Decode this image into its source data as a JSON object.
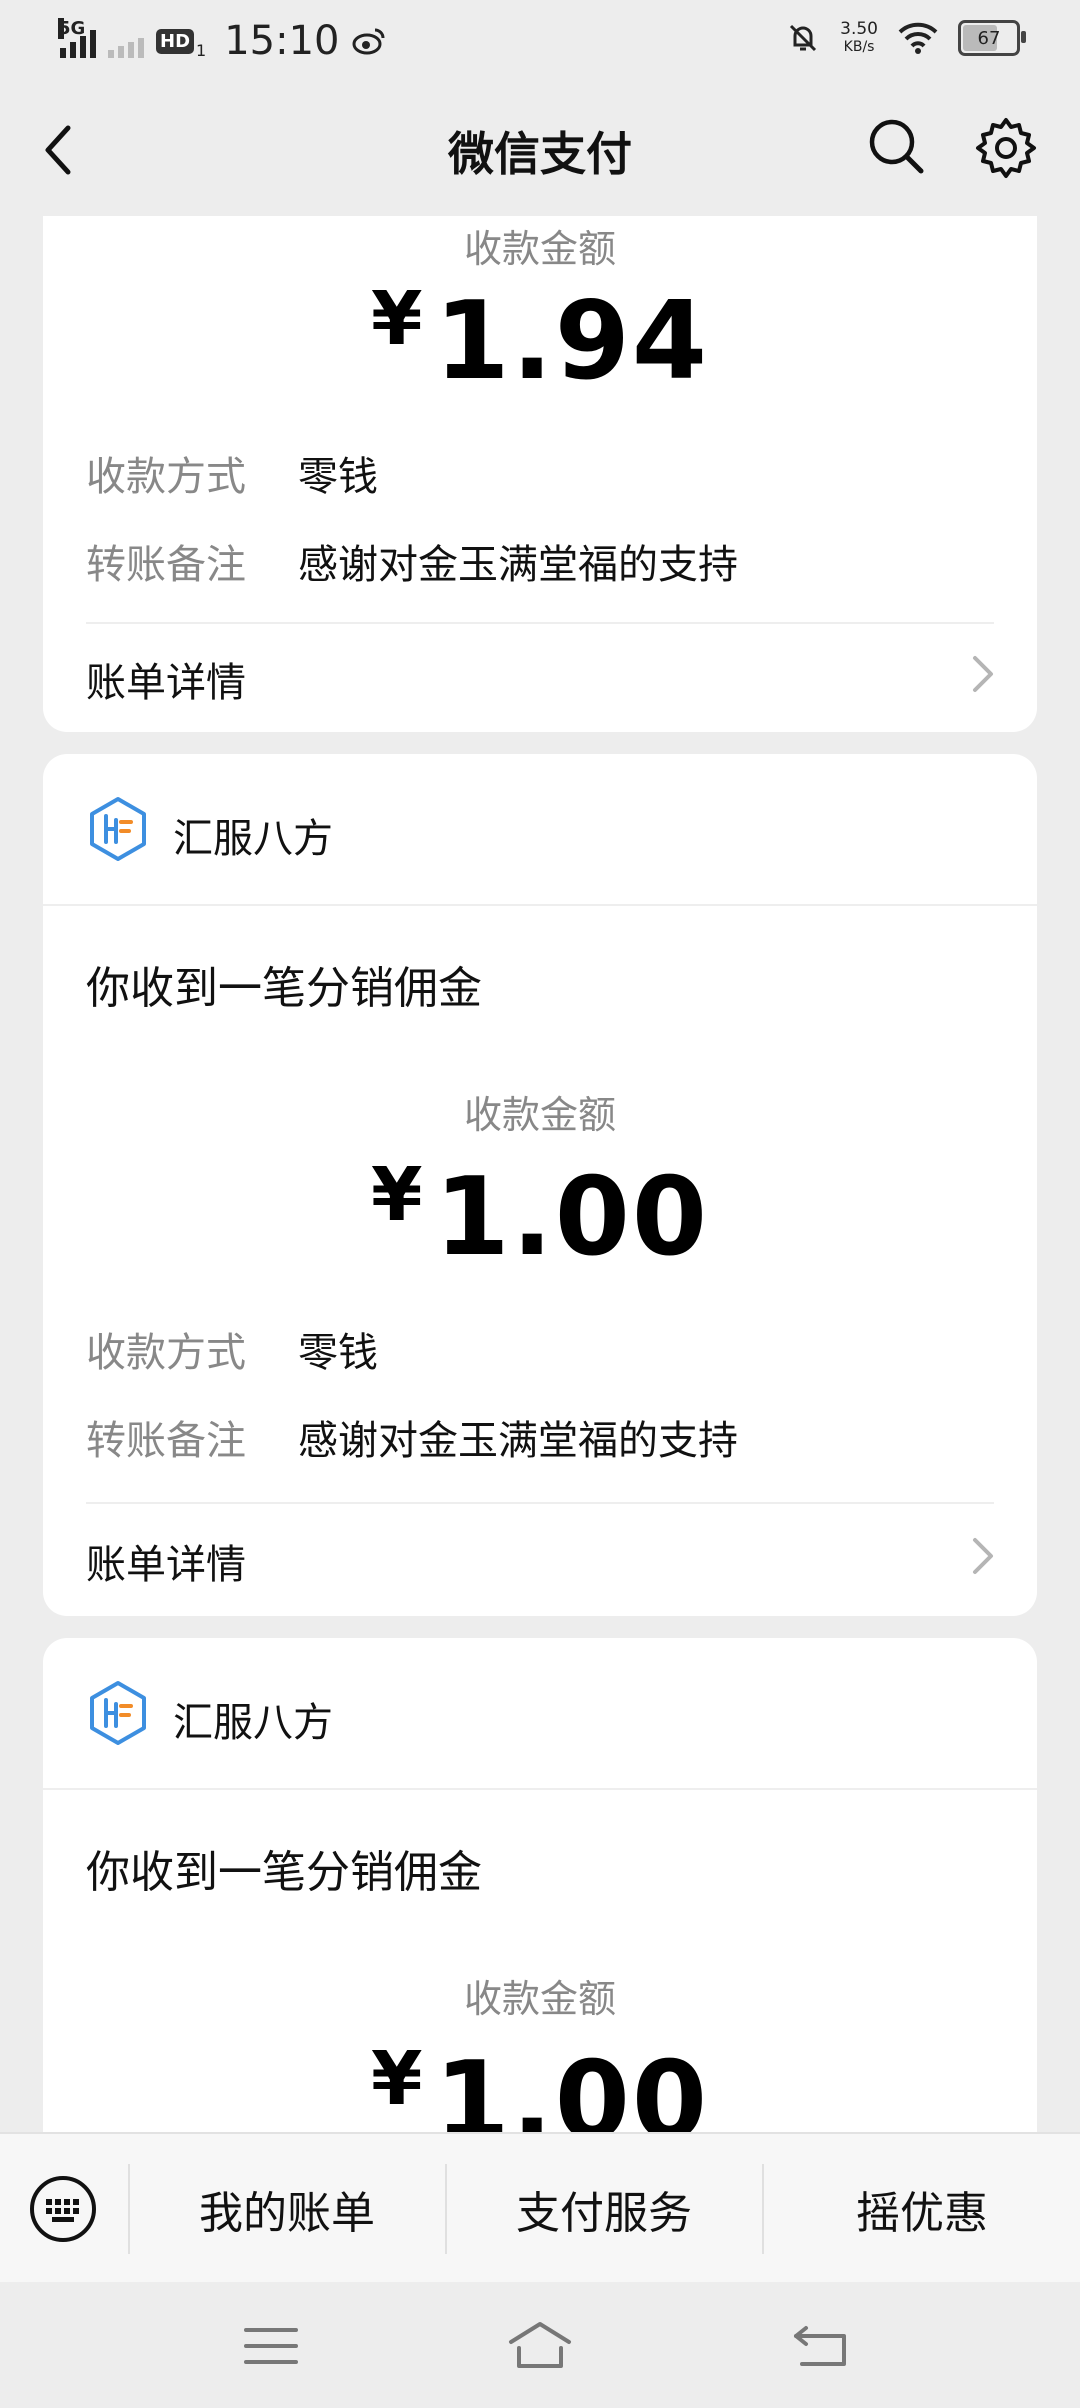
{
  "status_bar": {
    "network": "5G",
    "hd_badge": "HD",
    "sim_slot": "1",
    "time": "15:10",
    "speed_value": "3.50",
    "speed_unit": "KB/s",
    "battery": "67"
  },
  "header": {
    "title": "微信支付"
  },
  "cards": [
    {
      "amount_label": "收款金额",
      "currency": "¥",
      "amount": "1.94",
      "method_label": "收款方式",
      "method_value": "零钱",
      "note_label": "转账备注",
      "note_value": "感谢对金玉满堂福的支持",
      "detail_label": "账单详情"
    },
    {
      "merchant": "汇服八方",
      "headline": "你收到一笔分销佣金",
      "amount_label": "收款金额",
      "currency": "¥",
      "amount": "1.00",
      "method_label": "收款方式",
      "method_value": "零钱",
      "note_label": "转账备注",
      "note_value": "感谢对金玉满堂福的支持",
      "detail_label": "账单详情"
    },
    {
      "merchant": "汇服八方",
      "headline": "你收到一笔分销佣金",
      "amount_label": "收款金额",
      "currency": "¥",
      "amount": "1.00"
    }
  ],
  "bottom_menu": {
    "items": [
      {
        "label": "我的账单"
      },
      {
        "label": "支付服务"
      },
      {
        "label": "摇优惠"
      }
    ]
  },
  "colors": {
    "brand_blue": "#3d8fe0",
    "brand_orange": "#f28c28",
    "background": "#ededed"
  }
}
